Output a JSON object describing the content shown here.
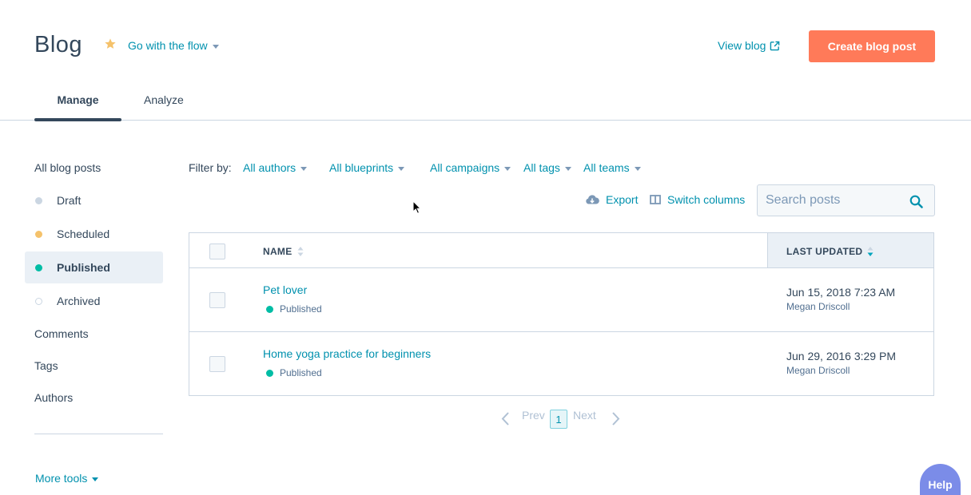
{
  "header": {
    "title": "Blog",
    "blog_name": "Go with the flow",
    "view_blog": "View blog",
    "create_button": "Create blog post"
  },
  "tabs": [
    {
      "label": "Manage",
      "active": true
    },
    {
      "label": "Analyze",
      "active": false
    }
  ],
  "sidebar": {
    "all_posts": "All blog posts",
    "statuses": [
      {
        "label": "Draft",
        "color": "#cbd6e2"
      },
      {
        "label": "Scheduled",
        "color": "#f5c26b"
      },
      {
        "label": "Published",
        "color": "#00bda5",
        "active": true
      },
      {
        "label": "Archived",
        "color": "hollow"
      }
    ],
    "links": [
      "Comments",
      "Tags",
      "Authors"
    ],
    "more_tools": "More tools"
  },
  "filters": {
    "label": "Filter by:",
    "options": [
      "All authors",
      "All blueprints",
      "All campaigns",
      "All tags",
      "All teams"
    ]
  },
  "actions": {
    "export": "Export",
    "switch_columns": "Switch columns"
  },
  "search": {
    "placeholder": "Search posts",
    "value": ""
  },
  "table": {
    "columns": [
      "NAME",
      "LAST UPDATED"
    ],
    "sorted_column": "LAST UPDATED",
    "rows": [
      {
        "title": "Pet lover",
        "status": "Published",
        "updated": "Jun 15, 2018 7:23 AM",
        "author": "Megan Driscoll"
      },
      {
        "title": "Home yoga practice for beginners",
        "status": "Published",
        "updated": "Jun 29, 2016 3:29 PM",
        "author": "Megan Driscoll"
      }
    ]
  },
  "pagination": {
    "prev": "Prev",
    "current": "1",
    "next": "Next"
  },
  "help": "Help",
  "colors": {
    "accent": "#0091ae",
    "primary_button": "#ff7a59",
    "published": "#00bda5",
    "help_button": "#7b8ce8"
  }
}
